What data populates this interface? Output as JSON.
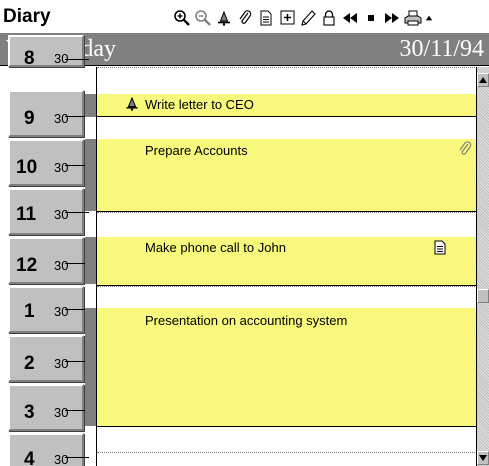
{
  "app": {
    "title": "Diary"
  },
  "toolbar": {
    "buttons": [
      {
        "name": "zoom-in",
        "icon": "zoom-in-icon"
      },
      {
        "name": "zoom-out",
        "icon": "zoom-out-icon"
      },
      {
        "name": "alarm",
        "icon": "bell-icon"
      },
      {
        "name": "attach",
        "icon": "paperclip-icon"
      },
      {
        "name": "note",
        "icon": "note-icon"
      },
      {
        "name": "insert",
        "icon": "plus-box-icon"
      },
      {
        "name": "edit",
        "icon": "pencil-icon"
      },
      {
        "name": "lock",
        "icon": "lock-icon"
      },
      {
        "name": "previous",
        "icon": "rewind-icon"
      },
      {
        "name": "today",
        "icon": "stop-icon"
      },
      {
        "name": "next",
        "icon": "fast-forward-icon"
      },
      {
        "name": "print",
        "icon": "printer-icon"
      },
      {
        "name": "scroll-up",
        "icon": "up-arrow-icon"
      }
    ]
  },
  "header": {
    "day": "Wednesday",
    "date": "30/11/94"
  },
  "time_column": {
    "hours": [
      {
        "hour": "8",
        "half": "30"
      },
      {
        "hour": "9",
        "half": "30"
      },
      {
        "hour": "10",
        "half": "30"
      },
      {
        "hour": "11",
        "half": "30"
      },
      {
        "hour": "12",
        "half": "30"
      },
      {
        "hour": "1",
        "half": "30"
      },
      {
        "hour": "2",
        "half": "30"
      },
      {
        "hour": "3",
        "half": "30"
      },
      {
        "hour": "4",
        "half": "30"
      }
    ]
  },
  "appointments": [
    {
      "text": "Write letter to CEO",
      "icon": "bell-icon"
    },
    {
      "text": "Prepare Accounts",
      "icon": "paperclip-icon"
    },
    {
      "text": "Make phone call to John",
      "icon": "note-icon"
    },
    {
      "text": "Presentation  on accounting system",
      "icon": ""
    }
  ],
  "colors": {
    "appointment_fill": "#ffff80",
    "header_bar": "#808080",
    "hour_block": "#c0c0c0",
    "busy_strip": "#808080"
  }
}
